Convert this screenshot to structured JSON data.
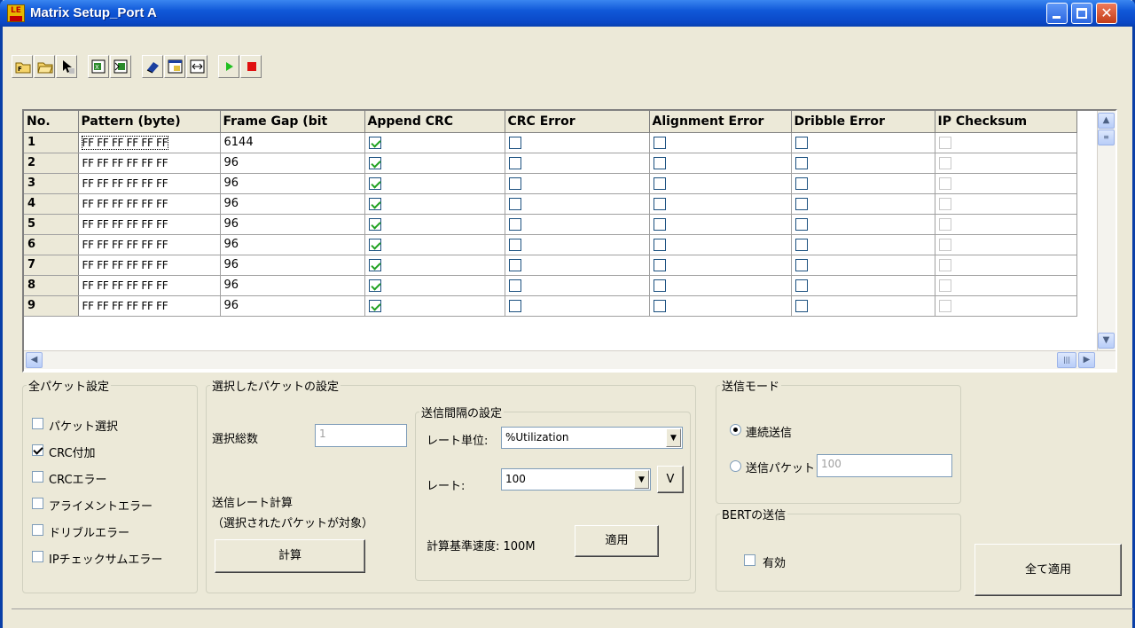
{
  "window": {
    "title": "Matrix Setup_Port A",
    "app_icon_text": "LE",
    "controls": [
      "minimize",
      "maximize",
      "close"
    ]
  },
  "toolbar": {
    "buttons": [
      {
        "name": "open-file-icon"
      },
      {
        "name": "open-folder-icon"
      },
      {
        "name": "pointer-icon"
      },
      {
        "name": "excel-export-icon"
      },
      {
        "name": "excel-import-icon"
      },
      {
        "name": "eraser-icon"
      },
      {
        "name": "window-icon"
      },
      {
        "name": "resize-horizontal-icon"
      },
      {
        "name": "play-icon"
      },
      {
        "name": "stop-icon"
      }
    ]
  },
  "grid": {
    "columns": [
      "No.",
      "Pattern (byte)",
      "Frame Gap (bit",
      "Append CRC",
      "CRC Error",
      "Alignment Error",
      "Dribble Error",
      "IP Checksum"
    ],
    "rows": [
      {
        "no": "1",
        "pattern": "FF FF FF FF FF FF",
        "gap": "6144",
        "append_crc": true,
        "crc_error": false,
        "alignment_error": false,
        "dribble_error": false,
        "ip_checksum": false
      },
      {
        "no": "2",
        "pattern": "FF FF FF FF FF FF",
        "gap": "96",
        "append_crc": true,
        "crc_error": false,
        "alignment_error": false,
        "dribble_error": false,
        "ip_checksum": false
      },
      {
        "no": "3",
        "pattern": "FF FF FF FF FF FF",
        "gap": "96",
        "append_crc": true,
        "crc_error": false,
        "alignment_error": false,
        "dribble_error": false,
        "ip_checksum": false
      },
      {
        "no": "4",
        "pattern": "FF FF FF FF FF FF",
        "gap": "96",
        "append_crc": true,
        "crc_error": false,
        "alignment_error": false,
        "dribble_error": false,
        "ip_checksum": false
      },
      {
        "no": "5",
        "pattern": "FF FF FF FF FF FF",
        "gap": "96",
        "append_crc": true,
        "crc_error": false,
        "alignment_error": false,
        "dribble_error": false,
        "ip_checksum": false
      },
      {
        "no": "6",
        "pattern": "FF FF FF FF FF FF",
        "gap": "96",
        "append_crc": true,
        "crc_error": false,
        "alignment_error": false,
        "dribble_error": false,
        "ip_checksum": false
      },
      {
        "no": "7",
        "pattern": "FF FF FF FF FF FF",
        "gap": "96",
        "append_crc": true,
        "crc_error": false,
        "alignment_error": false,
        "dribble_error": false,
        "ip_checksum": false
      },
      {
        "no": "8",
        "pattern": "FF FF FF FF FF FF",
        "gap": "96",
        "append_crc": true,
        "crc_error": false,
        "alignment_error": false,
        "dribble_error": false,
        "ip_checksum": false
      },
      {
        "no": "9",
        "pattern": "FF FF FF FF FF FF",
        "gap": "96",
        "append_crc": true,
        "crc_error": false,
        "alignment_error": false,
        "dribble_error": false,
        "ip_checksum": false
      }
    ]
  },
  "all_packet": {
    "legend": "全パケット設定",
    "options": [
      {
        "label": "パケット選択",
        "checked": false
      },
      {
        "label": "CRC付加",
        "checked": true
      },
      {
        "label": "CRCエラー",
        "checked": false
      },
      {
        "label": "アライメントエラー",
        "checked": false
      },
      {
        "label": "ドリブルエラー",
        "checked": false
      },
      {
        "label": "IPチェックサムエラー",
        "checked": false
      }
    ]
  },
  "selected_packet": {
    "legend": "選択したパケットの設定",
    "total_label": "選択総数",
    "total_value": "1",
    "rate_calc_label": "送信レート計算",
    "rate_calc_note": "（選択されたパケットが対象）",
    "calc_button": "計算"
  },
  "interval": {
    "legend": "送信間隔の設定",
    "unit_label": "レート単位:",
    "unit_value": "%Utilization",
    "rate_label": "レート:",
    "rate_value": "100",
    "v_button": "V",
    "base_speed": "計算基準速度: 100M",
    "apply_button": "適用"
  },
  "send_mode": {
    "legend": "送信モード",
    "continuous": "連続送信",
    "packet": "送信パケット",
    "packet_value": "100",
    "selected": "continuous"
  },
  "bert": {
    "legend": "BERTの送信",
    "enable_label": "有効",
    "enabled": false
  },
  "apply_all_button": "全て適用"
}
